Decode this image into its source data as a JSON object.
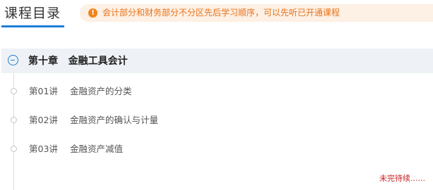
{
  "header": {
    "title": "课程目录",
    "notice": {
      "icon": "info-icon",
      "icon_glyph": "!",
      "text": "会计部分和财务部分不分区先后学习顺序，可以先听已开通课程",
      "color": "#e9721a"
    }
  },
  "chapter": {
    "title": "第十章   金融工具会计",
    "expanded": true,
    "lessons": [
      {
        "number": "第01讲",
        "title": "金融资产的分类"
      },
      {
        "number": "第02讲",
        "title": "金融资产的确认与计量"
      },
      {
        "number": "第03讲",
        "title": "金融资产减值"
      }
    ]
  },
  "footer_note": "未完待续......",
  "colors": {
    "accent": "#1e7fd6",
    "warning": "#f2831b",
    "alert_text": "#cc1f1f"
  }
}
